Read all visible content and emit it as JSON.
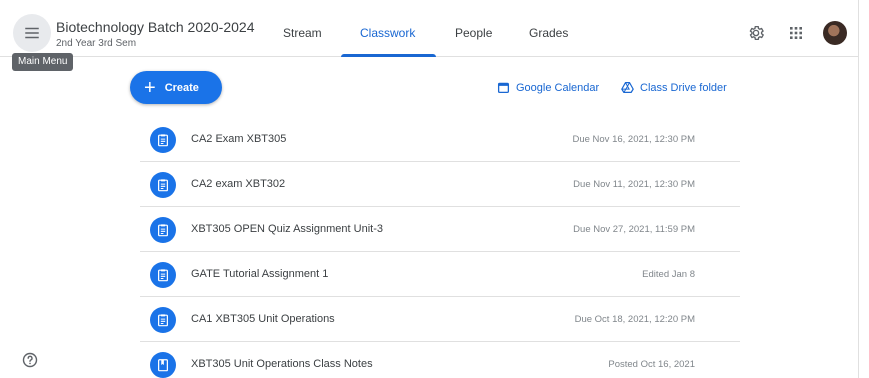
{
  "header": {
    "class_title": "Biotechnology Batch 2020-2024",
    "class_subtitle": "2nd Year 3rd Sem",
    "menu_tooltip": "Main Menu",
    "tabs": [
      {
        "label": "Stream",
        "active": false
      },
      {
        "label": "Classwork",
        "active": true
      },
      {
        "label": "People",
        "active": false
      },
      {
        "label": "Grades",
        "active": false
      }
    ],
    "icons": {
      "menu": "hamburger-icon",
      "settings": "gear-icon",
      "apps": "apps-grid-icon"
    }
  },
  "toolbar": {
    "create_label": "Create",
    "google_calendar_label": "Google Calendar",
    "class_drive_label": "Class Drive folder"
  },
  "items": [
    {
      "title": "CA2 Exam XBT305",
      "meta": "Due Nov 16, 2021, 12:30 PM",
      "icon": "assignment-icon"
    },
    {
      "title": "CA2 exam XBT302",
      "meta": "Due Nov 11, 2021, 12:30 PM",
      "icon": "assignment-icon"
    },
    {
      "title": "XBT305 OPEN Quiz Assignment Unit-3",
      "meta": "Due Nov 27, 2021, 11:59 PM",
      "icon": "assignment-icon"
    },
    {
      "title": "GATE Tutorial Assignment 1",
      "meta": "Edited Jan 8",
      "icon": "assignment-icon"
    },
    {
      "title": "CA1 XBT305 Unit Operations",
      "meta": "Due Oct 18, 2021, 12:20 PM",
      "icon": "assignment-icon"
    },
    {
      "title": "XBT305 Unit Operations Class Notes",
      "meta": "Posted Oct 16, 2021",
      "icon": "material-icon"
    }
  ],
  "colors": {
    "accent": "#1a73e8",
    "tab_active": "#1967d2"
  }
}
